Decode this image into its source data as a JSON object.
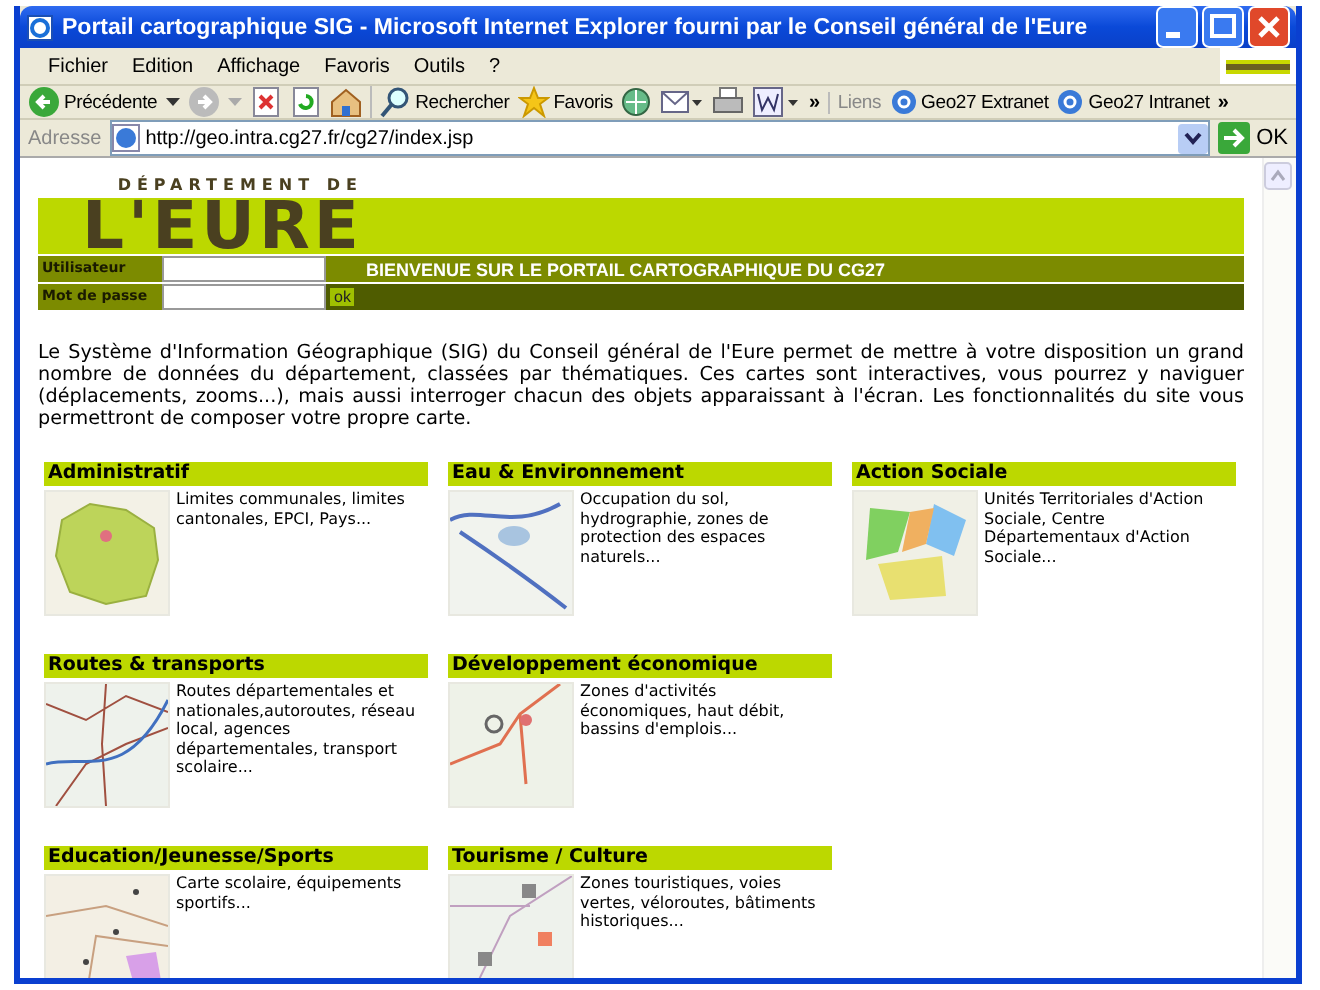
{
  "window": {
    "title": "Portail cartographique SIG - Microsoft Internet Explorer fourni par le Conseil général de l'Eure"
  },
  "menu": [
    "Fichier",
    "Edition",
    "Affichage",
    "Favoris",
    "Outils",
    "?"
  ],
  "toolbar": {
    "back": "Précédente",
    "search": "Rechercher",
    "favorites": "Favoris",
    "more": "»",
    "links_label": "Liens",
    "links": [
      "Geo27 Extranet",
      "Geo27 Intranet"
    ],
    "links_more": "»"
  },
  "address": {
    "label": "Adresse",
    "value": "http://geo.intra.cg27.fr/cg27/index.jsp",
    "go": "OK"
  },
  "page": {
    "logo_top": "DÉPARTEMENT DE",
    "logo": "L'EURE",
    "login": [
      {
        "label": "Utilisateur"
      },
      {
        "label": "Mot de passe"
      }
    ],
    "login_button": "ok",
    "welcome": "BIENVENUE SUR LE PORTAIL CARTOGRAPHIQUE DU CG27",
    "intro": "Le Système d'Information Géographique (SIG) du Conseil général de l'Eure permet de mettre à votre disposition un grand nombre de données du département, classées par thématiques. Ces cartes sont interactives, vous pourrez y naviguer (déplacements, zooms...), mais aussi interroger chacun des objets apparaissant à l'écran. Les fonctionnalités du site vous permettront de composer votre propre carte.",
    "category_rows": [
      [
        {
          "title": "Administratif",
          "description": "Limites communales, limites cantonales, EPCI, Pays..."
        },
        {
          "title": "Eau & Environnement",
          "description": "Occupation du sol, hydrographie, zones de protection des espaces naturels..."
        },
        {
          "title": "Action Sociale",
          "description": "Unités Territoriales d'Action Sociale, Centre Départementaux d'Action Sociale..."
        }
      ],
      [
        {
          "title": "Routes & transports",
          "description": "Routes départementales et nationales,autoroutes, réseau local, agences départementales, transport scolaire..."
        },
        {
          "title": "Développement économique",
          "description": "Zones d'activités économiques, haut débit, bassins d'emplois..."
        }
      ],
      [
        {
          "title": "Education/Jeunesse/Sports",
          "description": "Carte scolaire, équipements sportifs..."
        },
        {
          "title": "Tourisme / Culture",
          "description": "Zones touristiques, voies vertes, véloroutes, bâtiments historiques..."
        }
      ]
    ]
  }
}
